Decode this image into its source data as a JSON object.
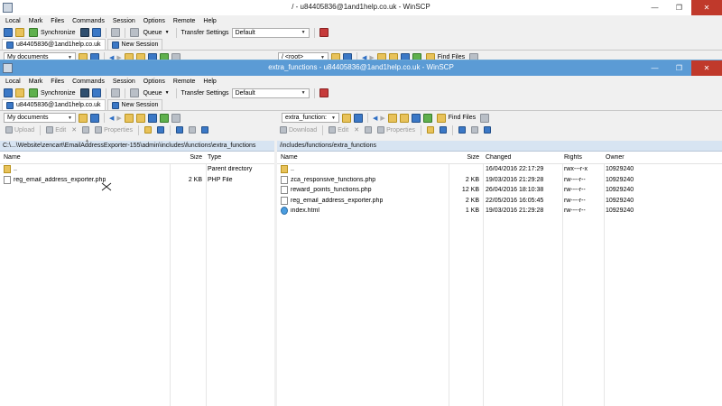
{
  "back_window": {
    "title": "/ - u84405836@1and1help.co.uk - WinSCP",
    "menu": [
      "Local",
      "Mark",
      "Files",
      "Commands",
      "Session",
      "Options",
      "Remote",
      "Help"
    ],
    "toolbar": {
      "synchronize": "Synchronize",
      "queue": "Queue",
      "transfer_settings": "Transfer Settings",
      "transfer_value": "Default"
    },
    "tabs": {
      "session": "u84405836@1and1help.co.uk",
      "new_session": "New Session"
    },
    "left_location": "My documents",
    "right_location": "/ <root>",
    "find_files": "Find Files"
  },
  "front_window": {
    "title": "extra_functions - u84405836@1and1help.co.uk - WinSCP",
    "menu": [
      "Local",
      "Mark",
      "Files",
      "Commands",
      "Session",
      "Options",
      "Remote",
      "Help"
    ],
    "toolbar": {
      "synchronize": "Synchronize",
      "queue": "Queue",
      "transfer_settings": "Transfer Settings",
      "transfer_value": "Default"
    },
    "tabs": {
      "session": "u84405836@1and1help.co.uk",
      "new_session": "New Session"
    },
    "left_location": "My documents",
    "right_location": "extra_function:",
    "find_files": "Find Files",
    "left_actions": {
      "upload": "Upload",
      "edit": "Edit",
      "properties": "Properties"
    },
    "right_actions": {
      "download": "Download",
      "edit": "Edit",
      "properties": "Properties"
    },
    "left_pane": {
      "path": "C:\\...\\Website\\zencart\\EmailAddressExporter-155\\admin\\includes\\functions\\extra_functions",
      "columns": {
        "name": "Name",
        "size": "Size",
        "type": "Type"
      },
      "rows": [
        {
          "name": "..",
          "size": "",
          "type": "Parent directory",
          "icon": "up-folder-icon"
        },
        {
          "name": "reg_email_address_exporter.php",
          "size": "2 KB",
          "type": "PHP File",
          "icon": "php-file-icon"
        }
      ]
    },
    "right_pane": {
      "path": "/includes/functions/extra_functions",
      "columns": {
        "name": "Name",
        "size": "Size",
        "changed": "Changed",
        "rights": "Rights",
        "owner": "Owner"
      },
      "rows": [
        {
          "name": "..",
          "size": "",
          "changed": "16/04/2016 22:17:29",
          "rights": "rwx---r-x",
          "owner": "10929240",
          "icon": "up-folder-icon"
        },
        {
          "name": "zca_responsive_functions.php",
          "size": "2 KB",
          "changed": "19/03/2016 21:29:28",
          "rights": "rw----r--",
          "owner": "10929240",
          "icon": "php-file-icon"
        },
        {
          "name": "reward_points_functions.php",
          "size": "12 KB",
          "changed": "26/04/2016 18:10:38",
          "rights": "rw----r--",
          "owner": "10929240",
          "icon": "php-file-icon"
        },
        {
          "name": "reg_email_address_exporter.php",
          "size": "2 KB",
          "changed": "22/05/2016 16:05:45",
          "rights": "rw----r--",
          "owner": "10929240",
          "icon": "php-file-icon"
        },
        {
          "name": "index.html",
          "size": "1 KB",
          "changed": "19/03/2016 21:29:28",
          "rights": "rw----r--",
          "owner": "10929240",
          "icon": "html-file-icon"
        }
      ]
    }
  },
  "colors": {
    "titlebar_active": "#5b9bd5",
    "path_header": "#d7e4f2",
    "close_button": "#c0392b"
  }
}
